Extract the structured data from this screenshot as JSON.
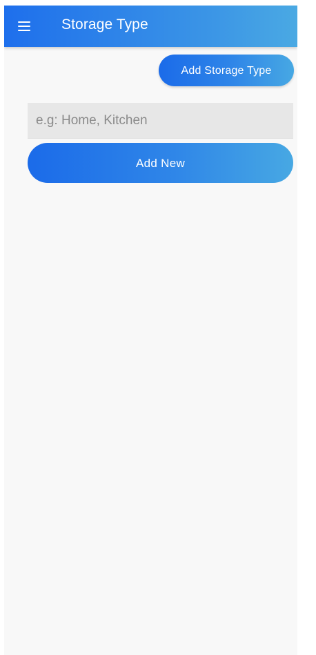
{
  "app_bar": {
    "title": "Storage Type",
    "menu_icon": "hamburger-menu-icon"
  },
  "actions": {
    "add_storage_type_label": "Add Storage Type"
  },
  "form": {
    "input_placeholder": "e.g: Home, Kitchen",
    "input_value": "",
    "submit_label": "Add New"
  },
  "colors": {
    "gradient_start": "#1e6fec",
    "gradient_end": "#4aa9e3",
    "background": "#f8f8f8",
    "input_background": "#e7e7e7"
  }
}
